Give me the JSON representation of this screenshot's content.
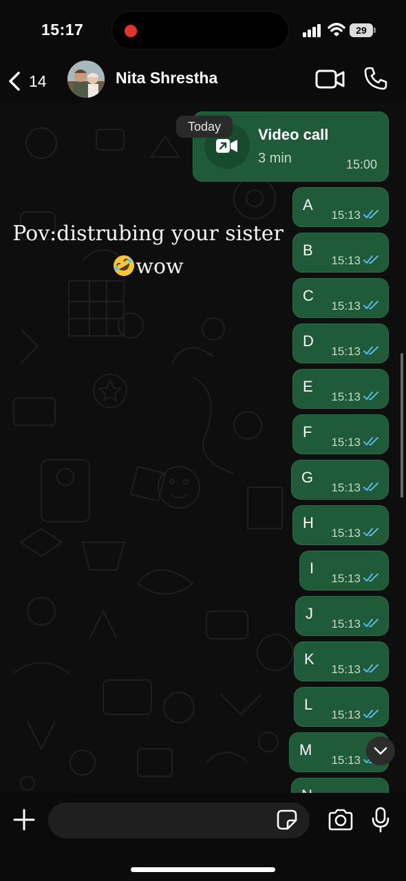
{
  "status_bar": {
    "time": "15:17",
    "battery": "29"
  },
  "header": {
    "back_count": "14",
    "contact_name": "Nita Shrestha"
  },
  "chat": {
    "date_badge": "Today",
    "call": {
      "title": "Video call",
      "duration": "3 min",
      "time": "15:00"
    },
    "overlay_line1": "Pov:distrubing your sister",
    "overlay_line2": "wow",
    "messages": [
      {
        "text": "A",
        "time": "15:13"
      },
      {
        "text": "B",
        "time": "15:13"
      },
      {
        "text": "C",
        "time": "15:13"
      },
      {
        "text": "D",
        "time": "15:13"
      },
      {
        "text": "E",
        "time": "15:13"
      },
      {
        "text": "F",
        "time": "15:13"
      },
      {
        "text": "G",
        "time": "15:13"
      },
      {
        "text": "H",
        "time": "15:13"
      },
      {
        "text": "I",
        "time": "15:13"
      },
      {
        "text": "J",
        "time": "15:13"
      },
      {
        "text": "K",
        "time": "15:13"
      },
      {
        "text": "L",
        "time": "15:13"
      },
      {
        "text": "M",
        "time": "15:13"
      },
      {
        "text": "N",
        "time": ""
      }
    ]
  },
  "colors": {
    "bubble": "#1f5a39",
    "tick": "#53bdeb",
    "background": "#0e0e0e"
  }
}
